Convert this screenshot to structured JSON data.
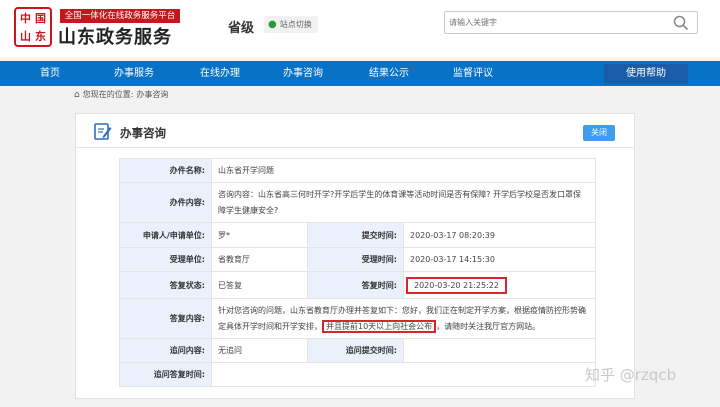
{
  "header": {
    "logo_chars": [
      "中",
      "国",
      "山",
      "东"
    ],
    "platform_subtitle": "全国一体化在线政务服务平台",
    "site_title": "山东政务服务",
    "region": "省级",
    "station_switch": "站点切换",
    "search": {
      "placeholder": "请输入关键字"
    }
  },
  "nav": {
    "items": [
      "首页",
      "办事服务",
      "在线办理",
      "办事咨询",
      "结果公示",
      "监督评议"
    ],
    "help_button": "使用帮助"
  },
  "breadcrumb": {
    "prefix": "您现在的位置:",
    "current": "办事咨询"
  },
  "panel": {
    "title": "办事咨询",
    "close_button": "关闭",
    "labels": {
      "item_name": "办件名称:",
      "item_content": "办件内容:",
      "applicant": "申请人/申请单位:",
      "submit_time": "提交时间:",
      "handling_unit": "受理单位:",
      "accept_time": "受理时间:",
      "reply_status": "答复状态:",
      "reply_time": "答复时间:",
      "reply_content": "答复内容:",
      "followup_question": "追问内容:",
      "followup_submit_time": "追问提交时间:",
      "followup_reply_time": "追问答复时间:"
    },
    "values": {
      "item_name": "山东省开学问题",
      "item_content": "咨询内容：山东省高三何时开学?开学后学生的体育课等活动时间是否有保障? 开学后学校是否发口罩保障学生健康安全?",
      "applicant": "罗*",
      "submit_time": "2020-03-17 08:20:39",
      "handling_unit": "省教育厅",
      "accept_time": "2020-03-17 14:15:30",
      "reply_status": "已答复",
      "reply_time": "2020-03-20 21:25:22",
      "reply_content_part1": "针对您咨询的问题，山东省教育厅办理并答复如下：您好，我们正在制定开学方案，根据疫情防控形势确定具体开学时间和开学安排，",
      "reply_content_highlight": "并且提前10天以上向社会公布",
      "reply_content_part2": "，请随时关注我厅官方网站。",
      "followup_question": "无追问",
      "followup_submit_time": "",
      "followup_reply_time": ""
    }
  },
  "watermark": "知乎 @rzqcb",
  "colors": {
    "brand_red": "#c8161d",
    "nav_blue": "#0872c7",
    "label_bg": "#eaf1fb",
    "highlight_red": "#d7262c"
  }
}
